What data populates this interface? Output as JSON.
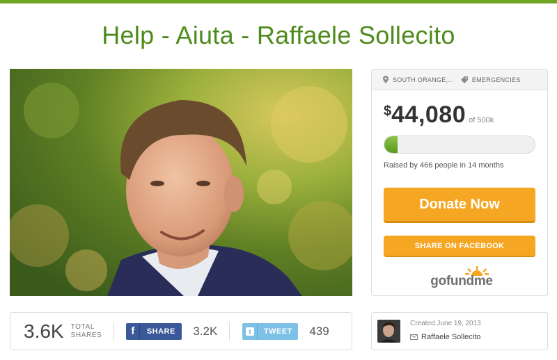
{
  "page": {
    "title": "Help - Aiuta - Raffaele Sollecito",
    "accent_color": "#6ea324"
  },
  "campaign": {
    "location": "SOUTH ORANGE,...",
    "location_icon": "map-pin-icon",
    "category": "EMERGENCIES",
    "category_icon": "tag-icon",
    "currency_symbol": "$",
    "amount_raised": "44,080",
    "goal": "of 500k",
    "progress_fraction": 0.088,
    "raised_text": "Raised by 466 people in 14 months",
    "donate_label": "Donate Now",
    "share_facebook_label": "SHARE ON FACEBOOK",
    "button_color": "#f5a623",
    "logo_text": "gofundme"
  },
  "shares": {
    "total_count": "3.6K",
    "total_label_line1": "TOTAL",
    "total_label_line2": "SHARES",
    "facebook_label": "SHARE",
    "facebook_count": "3.2K",
    "twitter_label": "TWEET",
    "twitter_count": "439"
  },
  "organizer": {
    "created": "Created June 19, 2013",
    "name": "Raffaele Sollecito",
    "name_icon": "envelope-icon"
  }
}
